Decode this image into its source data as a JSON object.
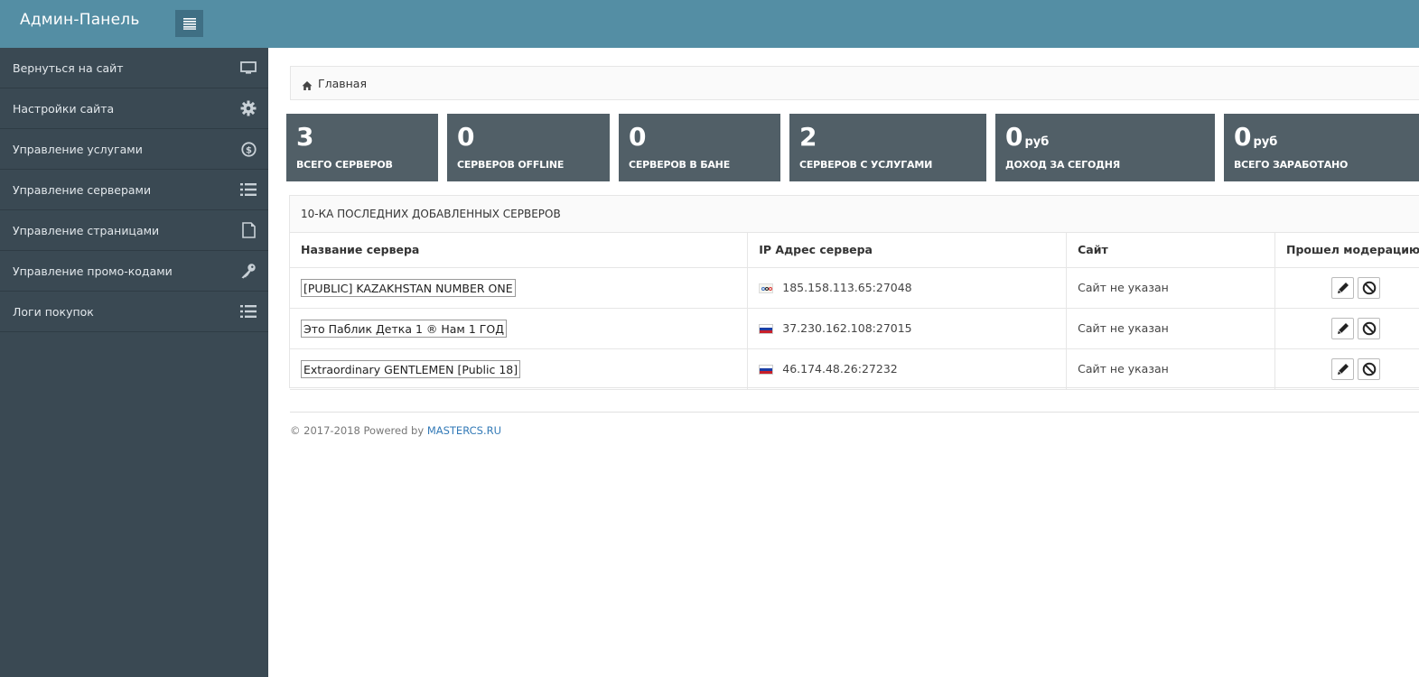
{
  "header": {
    "brand": "Админ-Панель",
    "menu_icon": "list-icon"
  },
  "sidebar": {
    "items": [
      {
        "label": "Вернуться на сайт",
        "icon": "monitor-icon"
      },
      {
        "label": "Настройки сайта",
        "icon": "gear-icon"
      },
      {
        "label": "Управление услугами",
        "icon": "dollar-circle-icon"
      },
      {
        "label": "Управление серверами",
        "icon": "list-icon"
      },
      {
        "label": "Управление страницами",
        "icon": "page-icon"
      },
      {
        "label": "Управление промо-кодами",
        "icon": "key-icon"
      },
      {
        "label": "Логи покупок",
        "icon": "list-icon"
      }
    ]
  },
  "breadcrumb": {
    "home": "Главная"
  },
  "stats": [
    {
      "value": "3",
      "unit": "",
      "caption": "ВСЕГО СЕРВЕРОВ"
    },
    {
      "value": "0",
      "unit": "",
      "caption": "СЕРВЕРОВ OFFLINE"
    },
    {
      "value": "0",
      "unit": "",
      "caption": "СЕРВЕРОВ В БАНЕ"
    },
    {
      "value": "2",
      "unit": "",
      "caption": "СЕРВЕРОВ С УСЛУГАМИ"
    },
    {
      "value": "0",
      "unit": "руб",
      "caption": "ДОХОД ЗА СЕГОДНЯ"
    },
    {
      "value": "0",
      "unit": "руб",
      "caption": "ВСЕГО ЗАРАБОТАНО"
    }
  ],
  "servers_panel": {
    "title": "10-КА ПОСЛЕДНИХ ДОБАВЛЕННЫХ СЕРВЕРОВ",
    "columns": [
      "Название сервера",
      "IP Адрес сервера",
      "Сайт",
      "Прошел модерацию?"
    ],
    "rows": [
      {
        "name": "[PUBLIC] KAZAKHSTAN NUMBER ONE",
        "flag": "olympic",
        "ip": "185.158.113.65:27048",
        "site": "Сайт не указан"
      },
      {
        "name": "Это Паблик Детка 1 ® Нам 1 ГОД",
        "flag": "ru",
        "ip": "37.230.162.108:27015",
        "site": "Сайт не указан"
      },
      {
        "name": "Extraordinary GENTLEMEN [Public 18]",
        "flag": "ru",
        "ip": "46.174.48.26:27232",
        "site": "Сайт не указан"
      }
    ]
  },
  "footer": {
    "text": "© 2017-2018 Powered by ",
    "link": "MASTERCS.RU"
  },
  "colors": {
    "header": "#548ea4",
    "sidebar": "#3a4953",
    "stat_tile": "#515f67",
    "link": "#337ab7"
  }
}
